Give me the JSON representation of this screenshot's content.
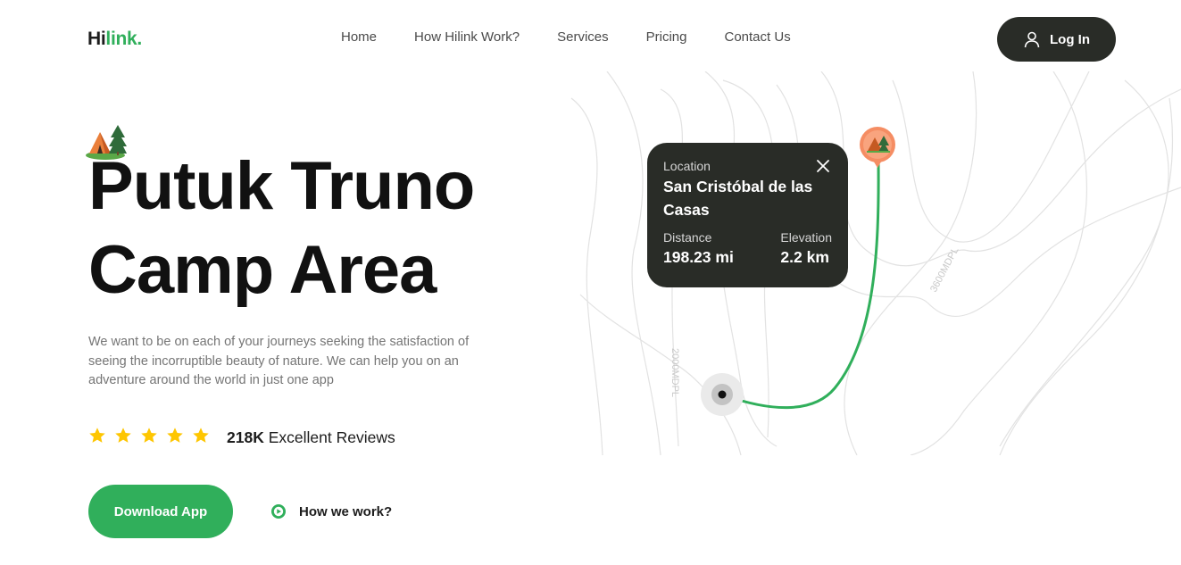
{
  "header": {
    "logo_part1": "Hi",
    "logo_part2": "link.",
    "nav": [
      "Home",
      "How Hilink Work?",
      "Services",
      "Pricing",
      "Contact Us"
    ],
    "login_label": "Log In"
  },
  "hero": {
    "title_line1": "Putuk Truno",
    "title_line2": "Camp Area",
    "description": "We want to be on each of your journeys seeking the satisfaction of seeing the incorruptible beauty of nature. We can help you on an adventure around the world in just one app",
    "rating_stars": 5,
    "reviews_count": "218K",
    "reviews_label": "Excellent Reviews",
    "download_label": "Download App",
    "how_work_label": "How we work?"
  },
  "map": {
    "contour_label_1": "3600MDPL",
    "contour_label_2": "2000MDPL",
    "popup": {
      "location_label": "Location",
      "location_value": "San Cristóbal de las Casas",
      "distance_label": "Distance",
      "distance_value": "198.23 mi",
      "elevation_label": "Elevation",
      "elevation_value": "2.2 km"
    }
  },
  "colors": {
    "brand_green": "#30af5b",
    "dark": "#292c27",
    "star": "#fec601",
    "pin_orange": "#f58d63"
  }
}
